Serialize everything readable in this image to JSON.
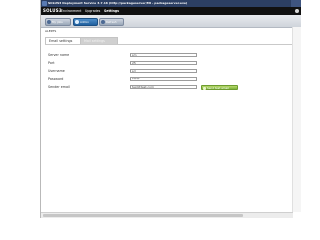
{
  "window": {
    "title": "SOLUS3 Deployment Service 3.7.16 (http://packageserver/MI - packageserver.exe)"
  },
  "menubar": {
    "brand": "SOLUS3",
    "items": [
      "Environment",
      "Upgrades",
      "Settings"
    ],
    "active": "Settings"
  },
  "toolbar": {
    "buttons": [
      "My jobs",
      "Admin",
      "Refresh"
    ]
  },
  "breadcrumb": "ALERTS",
  "tabs": [
    "Email settings",
    "Mail settings"
  ],
  "form": {
    "fields": [
      {
        "label": "Server name",
        "value": "sm"
      },
      {
        "label": "Port",
        "value": "25"
      },
      {
        "label": "Username",
        "value": "sd"
      },
      {
        "label": "Password",
        "value": "*****"
      },
      {
        "label": "Sender email",
        "value": "test@test.com"
      }
    ],
    "send_button": "Send test email"
  }
}
